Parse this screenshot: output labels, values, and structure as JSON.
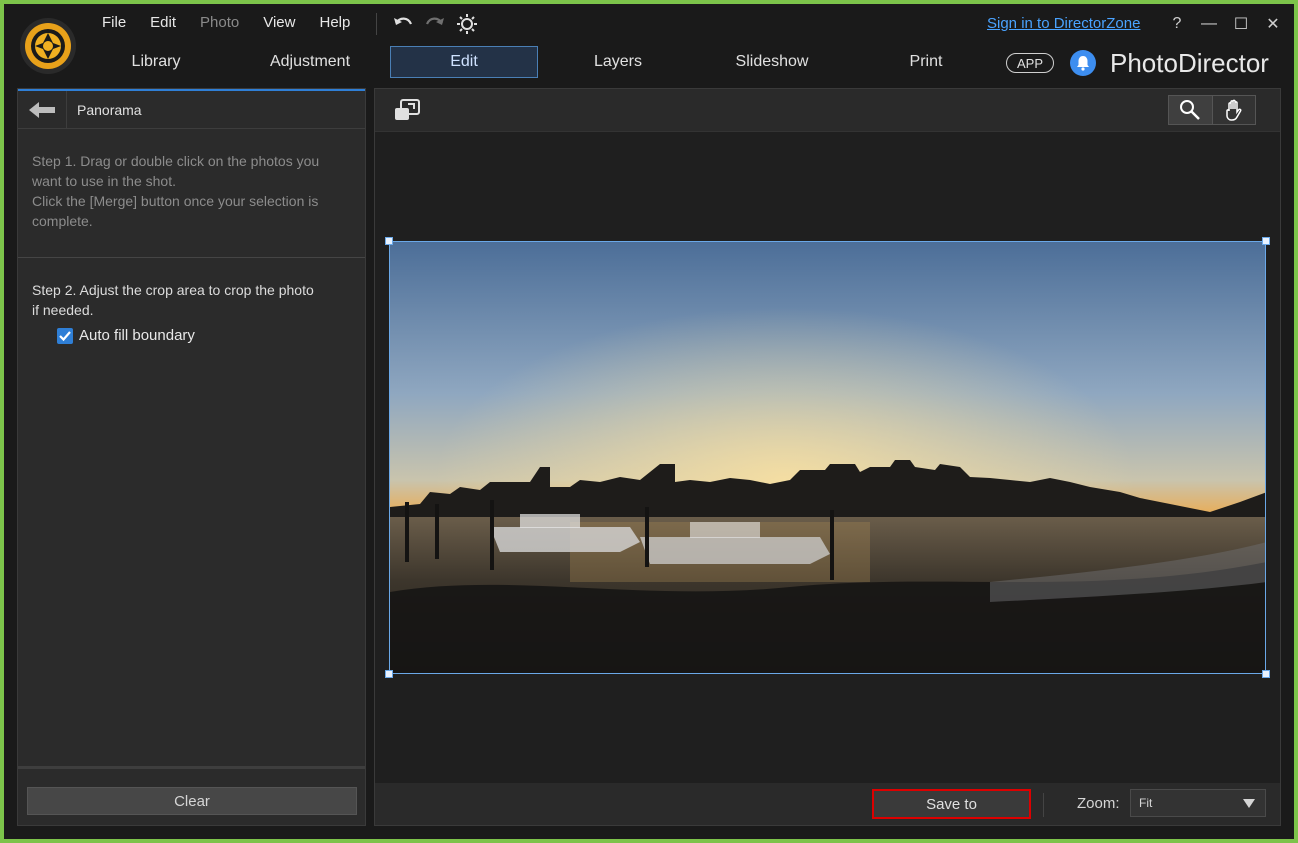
{
  "menu": {
    "items": [
      {
        "label": "File",
        "enabled": true
      },
      {
        "label": "Edit",
        "enabled": true
      },
      {
        "label": "Photo",
        "enabled": false
      },
      {
        "label": "View",
        "enabled": true
      },
      {
        "label": "Help",
        "enabled": true
      }
    ]
  },
  "toolbar": {
    "icons": [
      "undo-icon",
      "redo-icon",
      "settings-icon"
    ]
  },
  "header": {
    "signin_link": "Sign in to DirectorZone",
    "window_controls": [
      "?",
      "—",
      "☐",
      "✕"
    ],
    "app_badge": "APP",
    "brand": "PhotoDirector"
  },
  "tabs": [
    {
      "label": "Library",
      "active": false
    },
    {
      "label": "Adjustment",
      "active": false
    },
    {
      "label": "Edit",
      "active": true
    },
    {
      "label": "Layers",
      "active": false
    },
    {
      "label": "Slideshow",
      "active": false
    },
    {
      "label": "Print",
      "active": false
    }
  ],
  "panel": {
    "title": "Panorama",
    "step1_lines": [
      "Step 1. Drag or double click on the photos you",
      "want to use in the shot.",
      "Click the [Merge] button once your selection is",
      "complete."
    ],
    "step2_lines": [
      "Step 2. Adjust the crop area to crop the photo",
      "if needed."
    ],
    "auto_fill_label": "Auto fill boundary",
    "auto_fill_checked": true,
    "clear_label": "Clear"
  },
  "viewer": {
    "save_label": "Save to",
    "zoom_label": "Zoom:",
    "zoom_value": "Fit"
  },
  "colors": {
    "accent": "#2f7fd6",
    "window_border": "#7cc34a",
    "highlight_box": "#dd0000"
  }
}
